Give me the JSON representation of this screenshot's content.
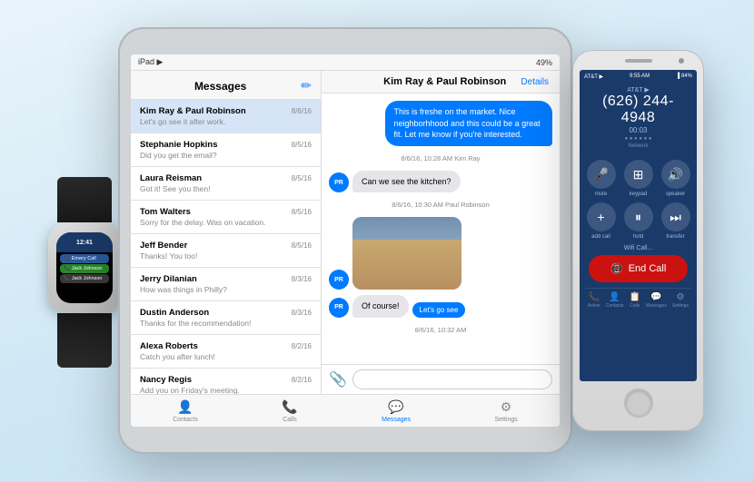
{
  "scene": {
    "background_color": "#d0e8f5"
  },
  "ipad": {
    "status_bar": {
      "left": "iPad ▶",
      "right": "49%"
    },
    "messages_panel": {
      "title": "Messages",
      "compose_icon": "✏",
      "items": [
        {
          "name": "Kim Ray & Paul Robinson",
          "date": "8/6/16",
          "preview": "Let's go see it after work.",
          "active": true
        },
        {
          "name": "Stephanie Hopkins",
          "date": "8/5/16",
          "preview": "Did you get the email?",
          "active": false
        },
        {
          "name": "Laura Reisman",
          "date": "8/5/16",
          "preview": "Got it! See you then!",
          "active": false
        },
        {
          "name": "Tom Walters",
          "date": "8/5/16",
          "preview": "Sorry for the delay. Was on vacation.",
          "active": false
        },
        {
          "name": "Jeff Bender",
          "date": "8/5/16",
          "preview": "Thanks! You too!",
          "active": false
        },
        {
          "name": "Jerry Dilanian",
          "date": "8/3/16",
          "preview": "How was things in Philly?",
          "active": false
        },
        {
          "name": "Dustin Anderson",
          "date": "8/3/16",
          "preview": "Thanks for the recommendation!",
          "active": false
        },
        {
          "name": "Alexa Roberts",
          "date": "8/2/16",
          "preview": "Catch you after lunch!",
          "active": false
        },
        {
          "name": "Nancy Regis",
          "date": "8/2/16",
          "preview": "Add you on Friday's meeting.",
          "active": false
        }
      ]
    },
    "chat_panel": {
      "title": "Kim Ray & Paul Robinson",
      "details_btn": "Details",
      "messages": [
        {
          "type": "right",
          "text": "This is freshe on the market. Nice neighborhhood and this could be a great fit. Let me know if you're interested.",
          "avatar": null
        },
        {
          "type": "timestamp",
          "text": "8/6/16, 10:28 AM Kim Ray"
        },
        {
          "type": "left",
          "text": "Can we see the kitchen?",
          "avatar": "PR"
        },
        {
          "type": "timestamp",
          "text": "8/6/16, 10:30 AM Paul Robinson"
        },
        {
          "type": "left-image",
          "avatar": "PR"
        },
        {
          "type": "left",
          "text": "Of course!",
          "avatar": "PR"
        },
        {
          "type": "timestamp",
          "text": "8/6/16, 10:32 AM"
        }
      ],
      "see_more": "Let's go see",
      "attachment_icon": "📎"
    },
    "nav_bar": {
      "items": [
        {
          "label": "Contacts",
          "icon": "👤",
          "active": false
        },
        {
          "label": "Calls",
          "icon": "📞",
          "active": false
        },
        {
          "label": "Messages",
          "icon": "💬",
          "active": true
        },
        {
          "label": "Settings",
          "icon": "⚙",
          "active": false
        }
      ]
    }
  },
  "iphone": {
    "status_bar": {
      "carrier": "AT&T ▶",
      "time": "9:55 AM",
      "battery": "▐ 84%"
    },
    "call_screen": {
      "carrier": "AT&T ▶",
      "phone_number": "(626) 244-4948",
      "duration": "00:03",
      "network_dots": "●●●●●●",
      "network_label": "Network"
    },
    "buttons": [
      {
        "label": "mute",
        "icon": "🎤"
      },
      {
        "label": "keypad",
        "icon": "⊞"
      },
      {
        "label": "speaker",
        "icon": "🔊"
      },
      {
        "label": "add call",
        "icon": "+"
      },
      {
        "label": "hold",
        "icon": "⏸"
      },
      {
        "label": "transfer",
        "icon": "⏭"
      }
    ],
    "wifi_call_label": "Wifi Call...",
    "end_call_label": "End Call",
    "end_call_icon": "📵",
    "tab_bar": {
      "items": [
        {
          "label": "Active",
          "icon": "📞"
        },
        {
          "label": "Contacts",
          "icon": "👤"
        },
        {
          "label": "Calls",
          "icon": "📋"
        },
        {
          "label": "Messages",
          "icon": "💬"
        },
        {
          "label": "Settings",
          "icon": "⚙"
        }
      ]
    }
  },
  "watch": {
    "time": "12:41",
    "call_items": [
      {
        "label": "Emery Call",
        "type": "blue"
      },
      {
        "label": "Jack Johnson",
        "type": "green"
      },
      {
        "label": "Jack Johnson",
        "type": "gray"
      }
    ]
  }
}
